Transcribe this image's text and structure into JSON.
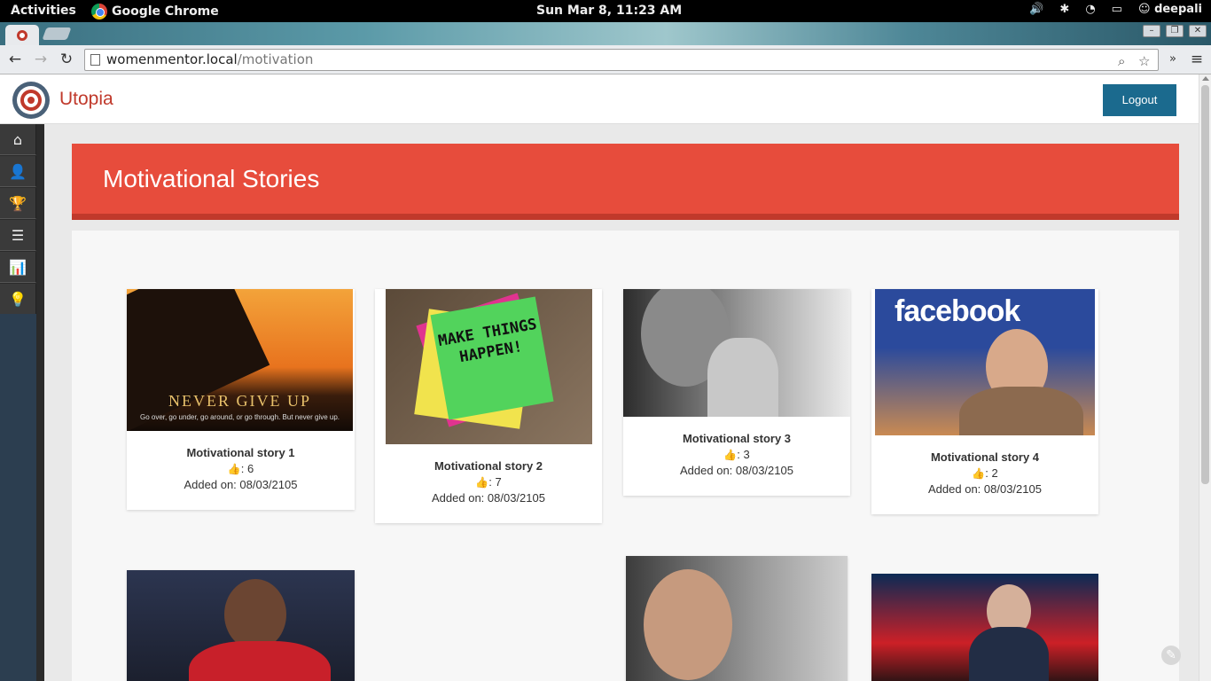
{
  "os": {
    "activities": "Activities",
    "app_name": "Google Chrome",
    "clock": "Sun Mar  8, 11:23 AM",
    "user": "deepali"
  },
  "browser": {
    "url_host": "womenmentor.local",
    "url_path": "/motivation"
  },
  "site": {
    "brand": "Utopia",
    "logout_label": "Logout"
  },
  "sidebar": {
    "items": [
      {
        "icon": "home-icon",
        "glyph": "⌂"
      },
      {
        "icon": "user-icon",
        "glyph": "👤"
      },
      {
        "icon": "trophy-icon",
        "glyph": "🏆"
      },
      {
        "icon": "list-icon",
        "glyph": "☰"
      },
      {
        "icon": "bar-chart-icon",
        "glyph": "📊"
      },
      {
        "icon": "lightbulb-icon",
        "glyph": "💡"
      }
    ]
  },
  "main": {
    "heading": "Motivational Stories",
    "stories": [
      {
        "title": "Motivational story 1",
        "likes": ": 6",
        "date": "Added on: 08/03/2105",
        "image_text": "NEVER GIVE UP",
        "image_subtext": "Go over, go under, go around, or go through. But never give up."
      },
      {
        "title": "Motivational story 2",
        "likes": ": 7",
        "date": "Added on: 08/03/2105",
        "image_text": "MAKE THINGS HAPPEN!"
      },
      {
        "title": "Motivational story 3",
        "likes": ": 3",
        "date": "Added on: 08/03/2105"
      },
      {
        "title": "Motivational story 4",
        "likes": ": 2",
        "date": "Added on: 08/03/2105",
        "image_text": "facebook"
      }
    ]
  },
  "colors": {
    "banner": "#e74c3c",
    "banner_border": "#c0392b",
    "logout": "#1b6a8e",
    "brand": "#c0392b",
    "sidebar": "#2c3e50"
  }
}
